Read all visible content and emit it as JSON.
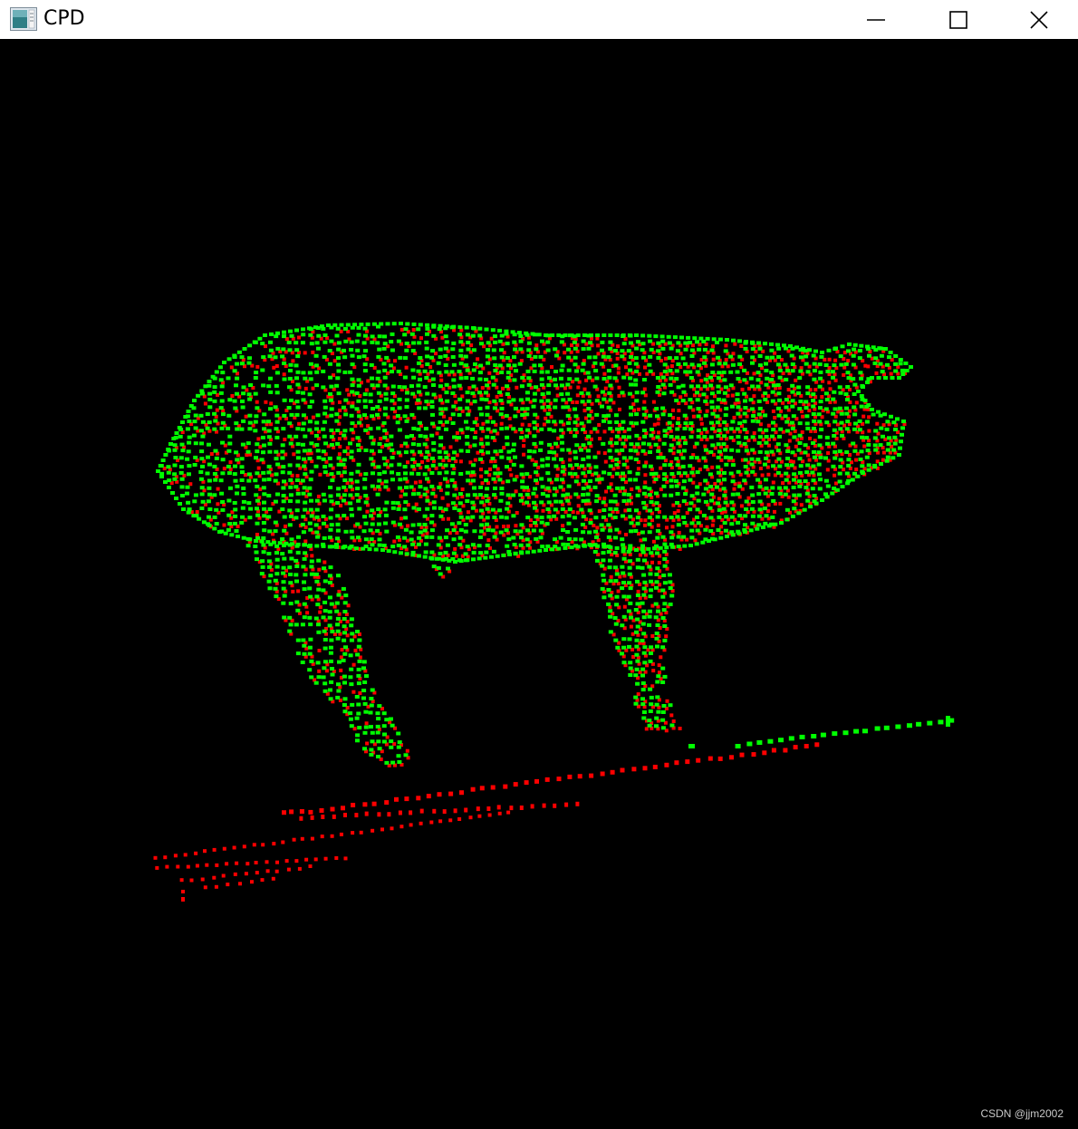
{
  "window": {
    "title": "CPD",
    "app_icon": "opengl-app-icon",
    "controls": {
      "minimize_icon": "minimize-icon",
      "maximize_icon": "maximize-icon",
      "close_icon": "close-icon"
    }
  },
  "scene": {
    "background_color": "#000000",
    "point_sets": [
      {
        "color": "#00ff00",
        "icon": "point-cloud-green"
      },
      {
        "color": "#ff0000",
        "icon": "point-cloud-red"
      }
    ]
  },
  "watermark": "CSDN @jjm2002"
}
